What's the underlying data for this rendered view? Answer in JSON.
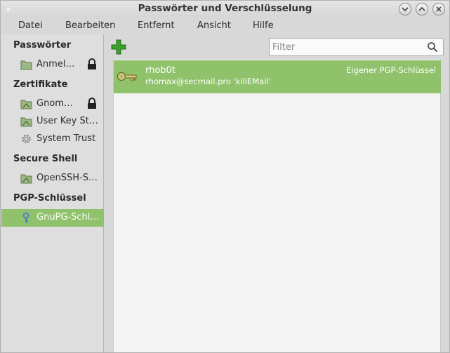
{
  "window": {
    "title": "Passwörter und Verschlüsselung"
  },
  "menu": [
    "Datei",
    "Bearbeiten",
    "Entfernt",
    "Ansicht",
    "Hilfe"
  ],
  "sidebar": {
    "sections": [
      {
        "heading": "Passwörter",
        "items": [
          {
            "label": "Anmel…",
            "locked": true
          }
        ]
      },
      {
        "heading": "Zertifikate",
        "items": [
          {
            "label": "Gnom…",
            "locked": true
          },
          {
            "label": "User Key St…",
            "locked": false
          },
          {
            "label": "System Trust",
            "locked": false
          }
        ]
      },
      {
        "heading": "Secure Shell",
        "items": [
          {
            "label": "OpenSSH-S…",
            "locked": false
          }
        ]
      },
      {
        "heading": "PGP-Schlüssel",
        "items": [
          {
            "label": "GnuPG-Schl…",
            "locked": false,
            "selected": true
          }
        ]
      }
    ]
  },
  "toolbar": {
    "filter_placeholder": "Filter"
  },
  "keys": [
    {
      "name": "rhob0t",
      "subtitle": "rhomax@secmail.pro 'killEMail'",
      "type": "Eigener PGP-Schlüssel"
    }
  ],
  "colors": {
    "selection": "#8fc26b",
    "add_icon": "#3aa02a"
  }
}
